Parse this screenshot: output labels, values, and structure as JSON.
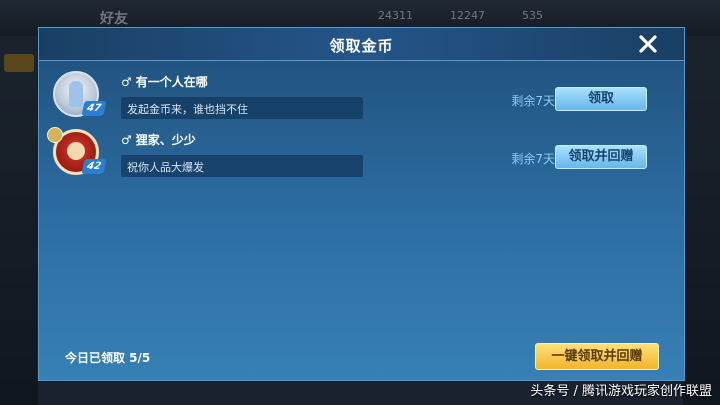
{
  "background": {
    "title": "好友",
    "stats": [
      "24311",
      "12247",
      "535"
    ]
  },
  "dialog": {
    "title": "领取金币",
    "close_icon": "close-icon"
  },
  "friends": [
    {
      "gender_icon": "♂",
      "name": "有一个人在哪",
      "message": "发起金币来，谁也挡不住",
      "level": "47",
      "remaining": "剩余7天",
      "button": "领取"
    },
    {
      "gender_icon": "♂",
      "name": "狸家、少少",
      "message": "祝你人品大爆发",
      "level": "42",
      "remaining": "剩余7天",
      "button": "领取并回赠"
    }
  ],
  "footer": {
    "claimed_today": "今日已领取 5/5",
    "claim_all_button": "一键领取并回赠"
  },
  "watermark": "头条号 / 腾讯游戏玩家创作联盟",
  "colors": {
    "accent_blue": "#67b6ec",
    "accent_gold": "#f1b52a",
    "remaining_text": "#8ecaf5"
  }
}
